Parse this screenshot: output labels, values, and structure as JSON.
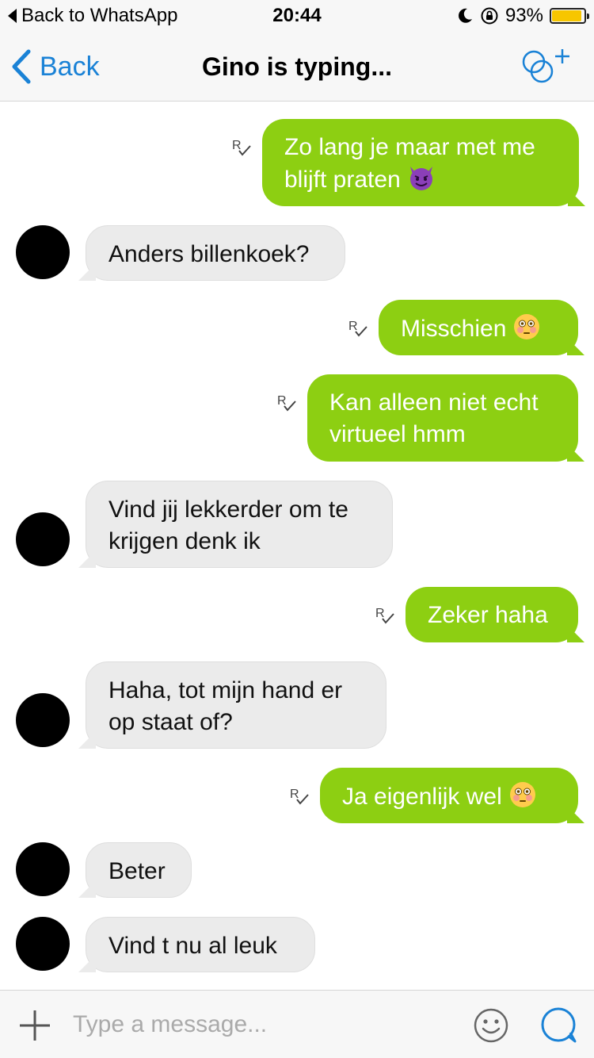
{
  "status_bar": {
    "back_label": "Back to WhatsApp",
    "time": "20:44",
    "battery_text": "93%",
    "battery_level": 0.93
  },
  "nav": {
    "back_label": "Back",
    "title": "Gino is typing..."
  },
  "messages": [
    {
      "direction": "out",
      "lines": [
        "Zo lang je maar met me",
        "blijft praten"
      ],
      "emoji": "devil-face"
    },
    {
      "direction": "in",
      "lines": [
        "Anders billenkoek?"
      ]
    },
    {
      "direction": "out",
      "lines": [
        "Misschien"
      ],
      "emoji": "flushed-face"
    },
    {
      "direction": "out",
      "lines": [
        "Kan alleen niet echt",
        "virtueel hmm"
      ]
    },
    {
      "direction": "in",
      "lines": [
        "Vind jij lekkerder om te",
        "krijgen denk ik"
      ]
    },
    {
      "direction": "out",
      "lines": [
        "Zeker haha"
      ]
    },
    {
      "direction": "in",
      "lines": [
        "Haha, tot mijn hand er",
        "op staat of?"
      ]
    },
    {
      "direction": "out",
      "lines": [
        "Ja eigenlijk wel"
      ],
      "emoji": "flushed-face"
    },
    {
      "direction": "in",
      "lines": [
        "Beter"
      ]
    },
    {
      "direction": "in",
      "lines": [
        "Vind t nu al leuk"
      ]
    }
  ],
  "input": {
    "placeholder": "Type a message..."
  },
  "colors": {
    "accent": "#1a82d6",
    "outgoing_bubble": "#8dcf12",
    "incoming_bubble": "#ebebeb",
    "battery": "#f7c600"
  }
}
